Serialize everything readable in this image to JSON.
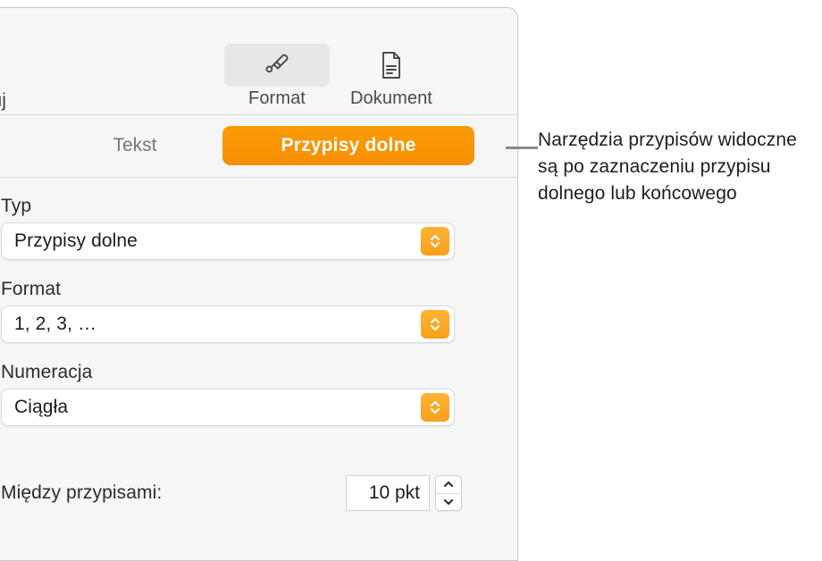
{
  "panel": {
    "toolbar": {
      "truncated_label": "racuj",
      "items": [
        {
          "label": "Format",
          "icon": "paintbrush-icon",
          "selected": true
        },
        {
          "label": "Dokument",
          "icon": "document-page-icon",
          "selected": false
        }
      ]
    },
    "tabs": [
      {
        "label": "Tekst",
        "selected": false
      },
      {
        "label": "Przypisy dolne",
        "selected": true
      }
    ],
    "fields": [
      {
        "label": "Typ",
        "value": "Przypisy dolne"
      },
      {
        "label": "Format",
        "value": "1, 2, 3, …"
      },
      {
        "label": "Numeracja",
        "value": "Ciągła"
      }
    ],
    "spacing": {
      "label": "Między przypisami:",
      "value": "10 pkt"
    }
  },
  "callout": {
    "text": "Narzędzia przypisów widoczne są po zaznaczeniu przypisu dolnego lub końcowego"
  },
  "colors": {
    "accent_orange": "#f89406",
    "stepper_orange": "#f9a01b",
    "panel_background": "#f6f6f6"
  }
}
